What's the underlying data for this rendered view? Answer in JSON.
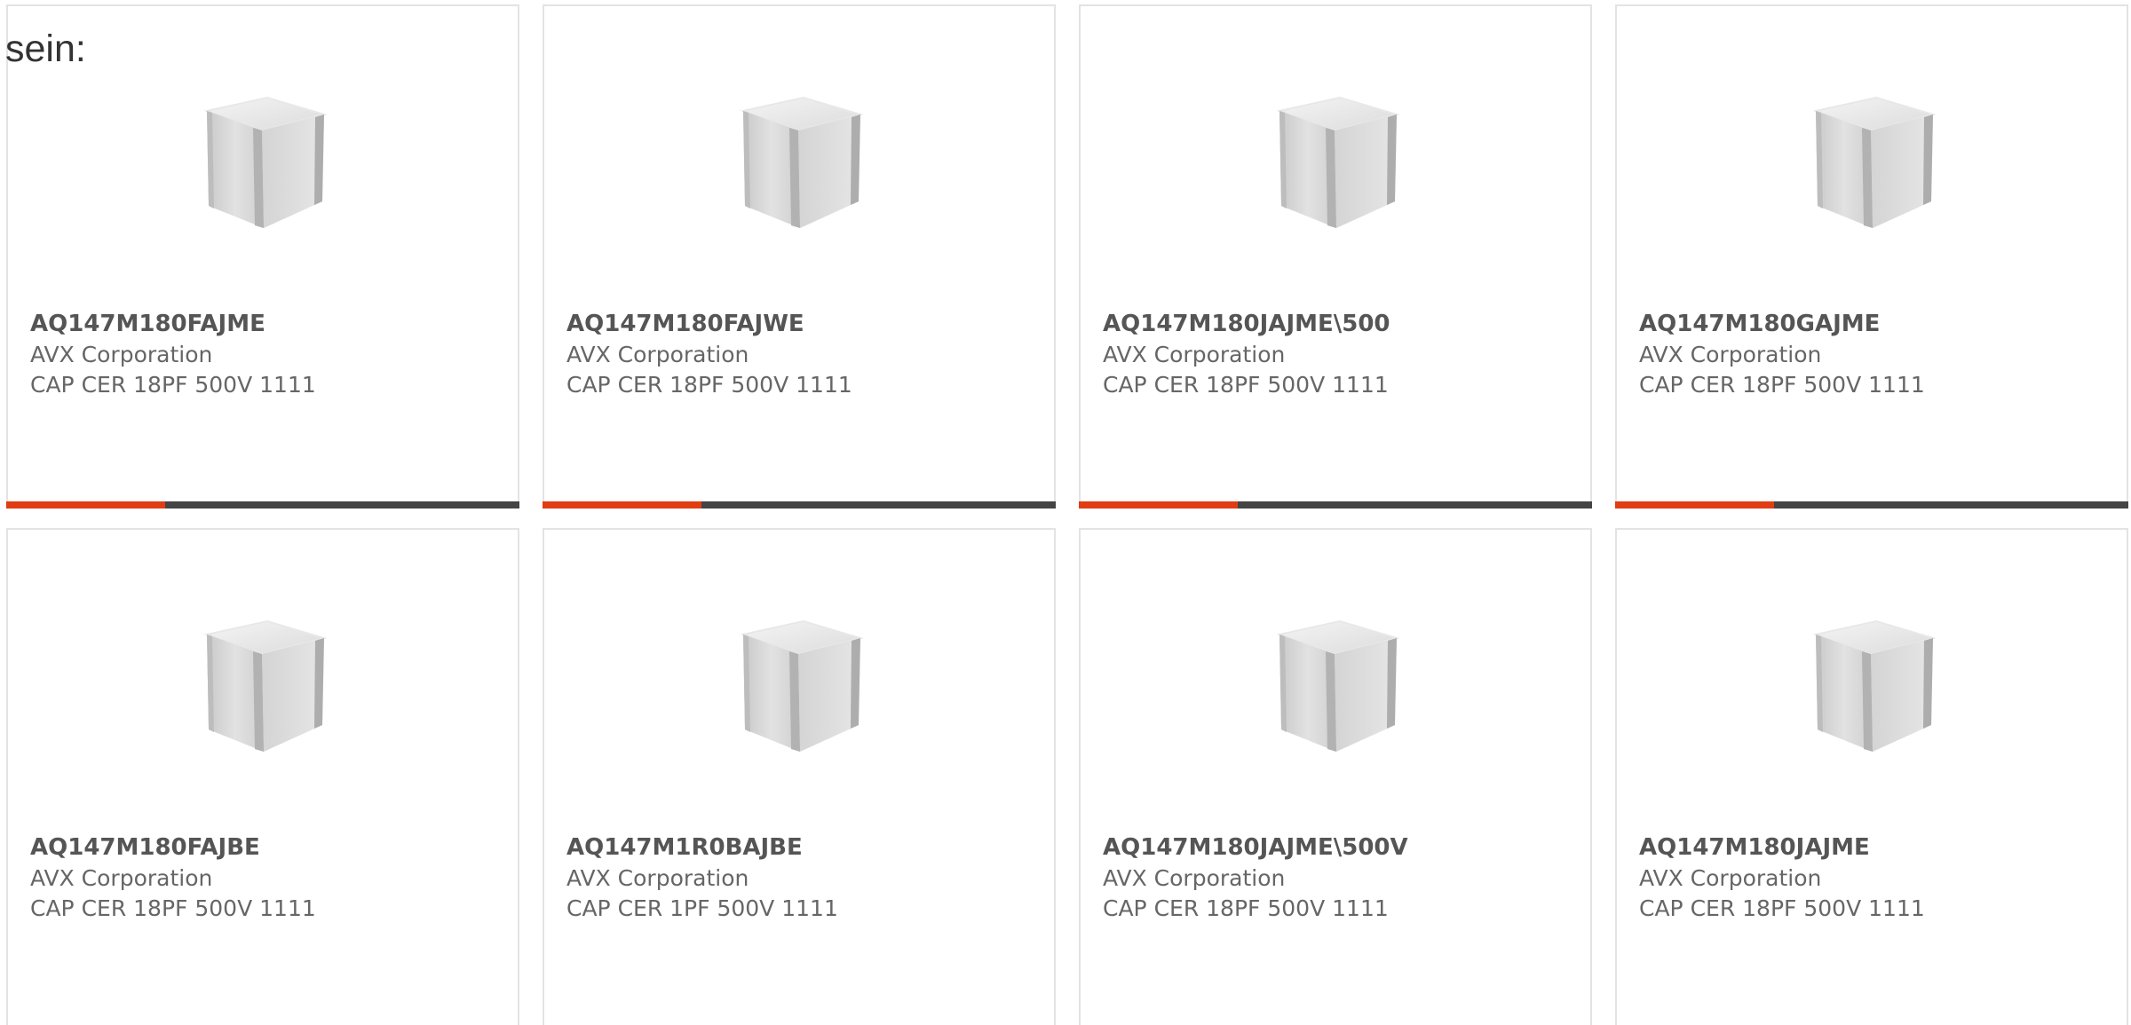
{
  "intro_text": "sein:",
  "colors": {
    "accent": "#e03d12",
    "bar_track": "#444444",
    "card_border": "#e3e3e3",
    "text": "#666666"
  },
  "cards": [
    {
      "part_number": "AQ147M180FAJME",
      "manufacturer": "AVX Corporation",
      "description": "CAP CER 18PF 500V 1111",
      "image_icon": "capacitor-cube-icon",
      "bar_fill_fraction": 0.31
    },
    {
      "part_number": "AQ147M180FAJWE",
      "manufacturer": "AVX Corporation",
      "description": "CAP CER 18PF 500V 1111",
      "image_icon": "capacitor-cube-icon",
      "bar_fill_fraction": 0.31
    },
    {
      "part_number": "AQ147M180JAJME\\500",
      "manufacturer": "AVX Corporation",
      "description": "CAP CER 18PF 500V 1111",
      "image_icon": "capacitor-cube-icon",
      "bar_fill_fraction": 0.31
    },
    {
      "part_number": "AQ147M180GAJME",
      "manufacturer": "AVX Corporation",
      "description": "CAP CER 18PF 500V 1111",
      "image_icon": "capacitor-cube-icon",
      "bar_fill_fraction": 0.31
    },
    {
      "part_number": "AQ147M180FAJBE",
      "manufacturer": "AVX Corporation",
      "description": "CAP CER 18PF 500V 1111",
      "image_icon": "capacitor-cube-icon"
    },
    {
      "part_number": "AQ147M1R0BAJBE",
      "manufacturer": "AVX Corporation",
      "description": "CAP CER 1PF 500V 1111",
      "image_icon": "capacitor-cube-icon"
    },
    {
      "part_number": "AQ147M180JAJME\\500V",
      "manufacturer": "AVX Corporation",
      "description": "CAP CER 18PF 500V 1111",
      "image_icon": "capacitor-cube-icon"
    },
    {
      "part_number": "AQ147M180JAJME",
      "manufacturer": "AVX Corporation",
      "description": "CAP CER 18PF 500V 1111",
      "image_icon": "capacitor-cube-icon"
    }
  ]
}
